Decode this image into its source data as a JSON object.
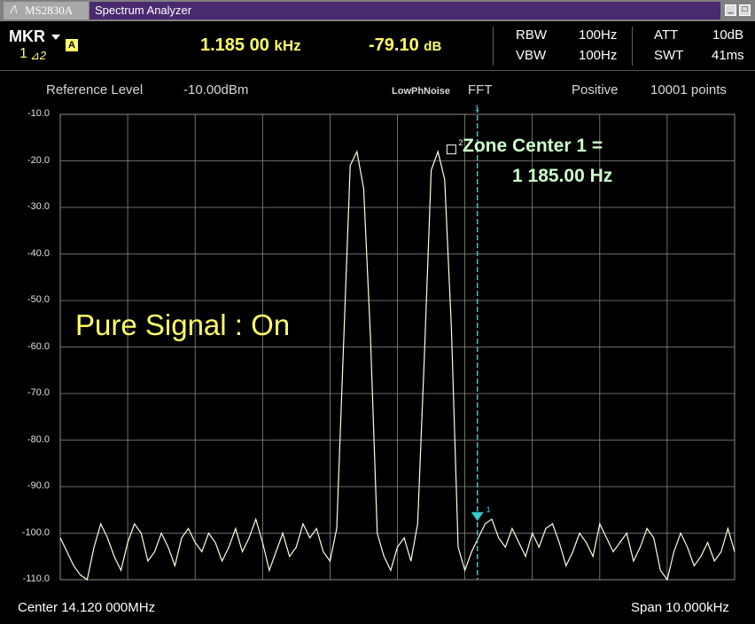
{
  "titlebar": {
    "logo_mark": "/\\",
    "model": "MS2830A",
    "app_title": "Spectrum Analyzer",
    "minimize_glyph": "_",
    "maximize_glyph": "□"
  },
  "marker": {
    "label": "MKR",
    "number": "1",
    "delta_label": "⊿2",
    "trace_badge": "A",
    "freq_value": "1.185 00",
    "freq_unit": "kHz",
    "level_value": "-79.10",
    "level_unit": "dB"
  },
  "settings": {
    "rbw_label": "RBW",
    "rbw_value": "100Hz",
    "vbw_label": "VBW",
    "vbw_value": "100Hz",
    "att_label": "ATT",
    "att_value": "10dB",
    "swt_label": "SWT",
    "swt_value": "41ms"
  },
  "info": {
    "ref_label": "Reference Level",
    "ref_value": "-10.00dBm",
    "phase_noise": "LowPhNoise",
    "mode": "FFT",
    "detector": "Positive",
    "points": "10001 points"
  },
  "annotations": {
    "pure_signal": "Pure Signal : On",
    "zone_line1": "Zone Center 1 =",
    "zone_line2": "1 185.00 Hz",
    "marker1_tag": "1",
    "marker2_tag": "2",
    "zone_line_tag": "1"
  },
  "footer": {
    "center": "Center 14.120 000MHz",
    "span": "Span 10.000kHz"
  },
  "colors": {
    "trace": "#ffffe0",
    "grid": "#8c8c8c",
    "zone_line": "#33cccc",
    "marker1": "#33cccc",
    "annotation_yellow": "#ffff66",
    "zone_text": "#ccffcc"
  },
  "chart_data": {
    "type": "line",
    "x_unit": "Hz offset from center",
    "xlim": [
      -5000,
      5000
    ],
    "ylim": [
      -110,
      -10
    ],
    "yticks": [
      "-10.0",
      "-20.0",
      "-30.0",
      "-40.0",
      "-50.0",
      "-60.0",
      "-70.0",
      "-80.0",
      "-90.0",
      "-100.0",
      "-110.0"
    ],
    "grid": true,
    "peaks": [
      {
        "x": -400,
        "y": -18.0
      },
      {
        "x": 800,
        "y": -18.3
      }
    ],
    "noise_floor": -104,
    "marker1": {
      "x": 1185,
      "y": -97.0
    },
    "marker2": {
      "x": 800,
      "y": -18.3
    },
    "zone_center_x": 1185,
    "series": [
      {
        "x": [
          -5000,
          -4900,
          -4800,
          -4700,
          -4600,
          -4500,
          -4400,
          -4300,
          -4200,
          -4100,
          -4000,
          -3900,
          -3800,
          -3700,
          -3600,
          -3500,
          -3400,
          -3300,
          -3200,
          -3100,
          -3000,
          -2900,
          -2800,
          -2700,
          -2600,
          -2500,
          -2400,
          -2300,
          -2200,
          -2100,
          -2000,
          -1900,
          -1800,
          -1700,
          -1600,
          -1500,
          -1400,
          -1300,
          -1200,
          -1100,
          -1000,
          -900,
          -800,
          -700,
          -600,
          -500,
          -400,
          -300,
          -200,
          -100,
          0,
          100,
          200,
          300,
          400,
          500,
          600,
          700,
          800,
          900,
          1000,
          1100,
          1200,
          1300,
          1400,
          1500,
          1600,
          1700,
          1800,
          1900,
          2000,
          2100,
          2200,
          2300,
          2400,
          2500,
          2600,
          2700,
          2800,
          2900,
          3000,
          3100,
          3200,
          3300,
          3400,
          3500,
          3600,
          3700,
          3800,
          3900,
          4000,
          4100,
          4200,
          4300,
          4400,
          4500,
          4600,
          4700,
          4800,
          4900,
          5000
        ],
        "y": [
          -101,
          -104,
          -107,
          -109,
          -110,
          -103,
          -98,
          -101,
          -105,
          -108,
          -102,
          -98,
          -100,
          -106,
          -104,
          -100,
          -103,
          -107,
          -101,
          -99,
          -102,
          -104,
          -100,
          -102,
          -106,
          -103,
          -99,
          -104,
          -101,
          -97,
          -102,
          -108,
          -104,
          -100,
          -105,
          -103,
          -98,
          -101,
          -99,
          -104,
          -106,
          -99,
          -60,
          -21,
          -18,
          -26,
          -58,
          -100,
          -105,
          -108,
          -103,
          -101,
          -106,
          -98,
          -62,
          -22,
          -18,
          -24,
          -56,
          -103,
          -108,
          -104,
          -101,
          -98,
          -97,
          -101,
          -103,
          -99,
          -102,
          -105,
          -100,
          -103,
          -99,
          -98,
          -102,
          -107,
          -104,
          -100,
          -102,
          -105,
          -98,
          -101,
          -104,
          -102,
          -100,
          -106,
          -103,
          -99,
          -101,
          -108,
          -110,
          -104,
          -100,
          -103,
          -107,
          -105,
          -102,
          -106,
          -104,
          -99,
          -104
        ]
      }
    ]
  }
}
